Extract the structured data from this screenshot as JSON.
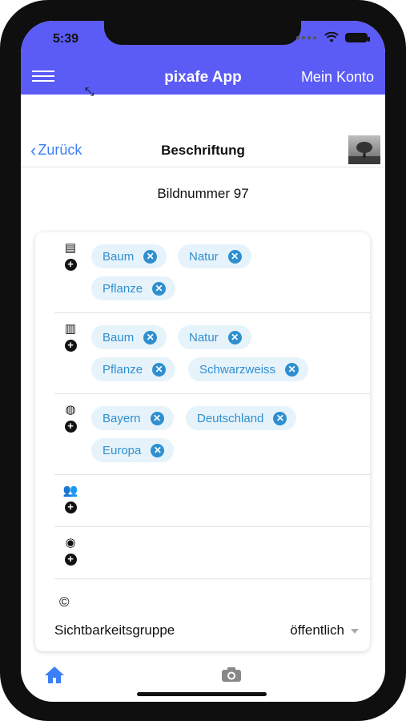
{
  "status_bar": {
    "time": "5:39"
  },
  "header": {
    "title": "pixafe App",
    "account": "Mein Konto"
  },
  "nav": {
    "back": "Zurück",
    "title": "Beschriftung"
  },
  "image_number": "Bildnummer 97",
  "sections": [
    {
      "icon": "newspaper-icon",
      "chips": [
        "Baum",
        "Natur",
        "Pflanze"
      ]
    },
    {
      "icon": "inbox-icon",
      "chips": [
        "Baum",
        "Natur",
        "Pflanze",
        "Schwarzweiss"
      ]
    },
    {
      "icon": "globe-icon",
      "chips": [
        "Bayern",
        "Deutschland",
        "Europa"
      ]
    },
    {
      "icon": "people-icon",
      "chips": []
    },
    {
      "icon": "person-icon",
      "chips": []
    }
  ],
  "copyright": "©",
  "visibility": {
    "label": "Sichtbarkeitsgruppe",
    "value": "öffentlich"
  },
  "colors": {
    "header": "#5b5bf5",
    "link": "#3a7ff6",
    "chip_bg": "#e6f3fb",
    "chip_text": "#2e8fd0"
  }
}
